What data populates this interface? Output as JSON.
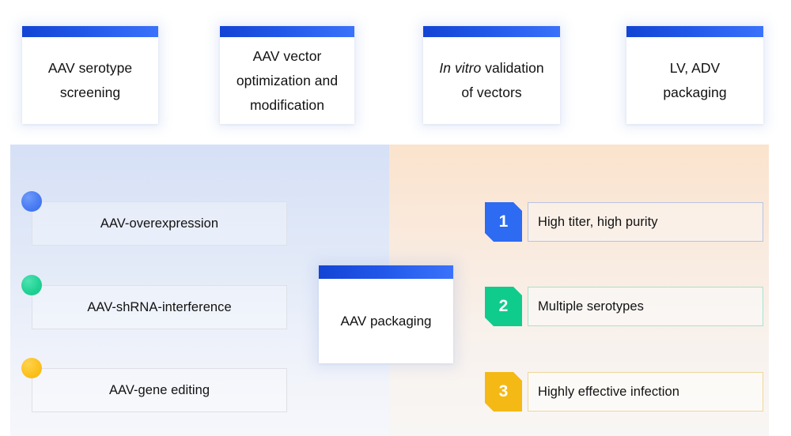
{
  "top_cards": [
    {
      "id": "aav-serotype-screening",
      "lines": [
        "AAV serotype",
        "screening"
      ],
      "italic_lead": ""
    },
    {
      "id": "aav-vector-optimization",
      "lines": [
        "AAV vector",
        "optimization and",
        "modification"
      ],
      "italic_lead": ""
    },
    {
      "id": "in-vitro-validation",
      "lines": [
        "In vitro validation",
        "of vectors"
      ],
      "italic_lead": "In vitro"
    },
    {
      "id": "lv-adv-packaging",
      "lines": [
        "LV, ADV",
        "packaging"
      ],
      "italic_lead": ""
    }
  ],
  "left_panel": {
    "items": [
      {
        "id": "aav-overexpression",
        "label": "AAV-overexpression",
        "dot_color": "#4a7cf3",
        "dot_name": "blue-dot"
      },
      {
        "id": "aav-shrna-interference",
        "label": "AAV-shRNA-interference",
        "dot_color": "#22d295",
        "dot_name": "green-dot"
      },
      {
        "id": "aav-gene-editing",
        "label": "AAV-gene editing",
        "dot_color": "#fcc11e",
        "dot_name": "yellow-dot"
      }
    ]
  },
  "center_card": {
    "id": "aav-packaging",
    "label": "AAV packaging"
  },
  "right_panel": {
    "items": [
      {
        "id": "high-titer-high-purity",
        "number": "1",
        "label": "High titer, high purity",
        "badge_color": "#2c6bf2"
      },
      {
        "id": "multiple-serotypes",
        "number": "2",
        "label": "Multiple serotypes",
        "badge_color": "#10cc8c"
      },
      {
        "id": "highly-effective-infection",
        "number": "3",
        "label": "Highly effective infection",
        "badge_color": "#f5b916"
      }
    ]
  },
  "theme": {
    "card_bar_gradient_start": "#1344d4",
    "card_bar_gradient_end": "#3a72fb",
    "panel_left_bg": "#d6e0f6",
    "panel_right_bg": "#fbe3cd"
  }
}
